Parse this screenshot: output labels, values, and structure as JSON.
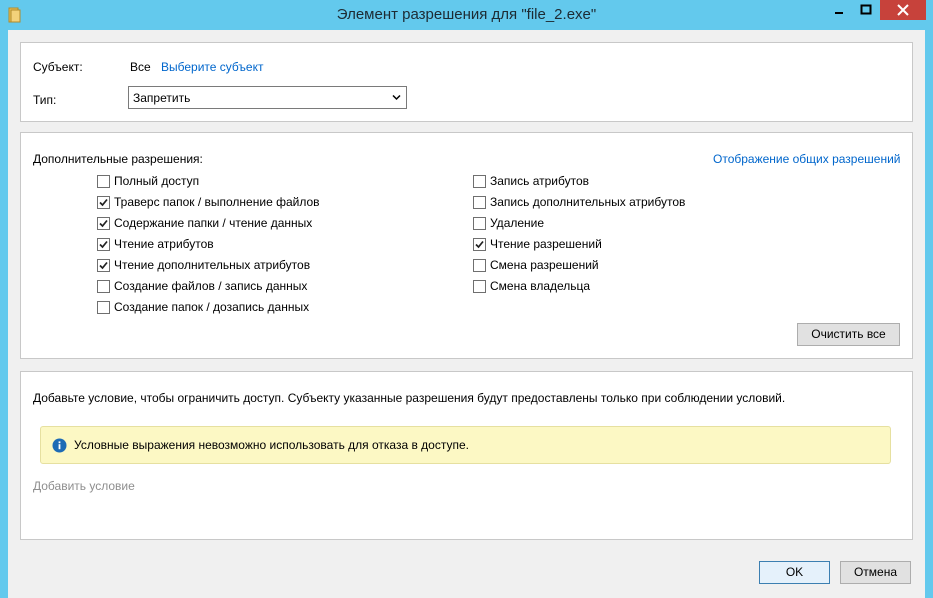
{
  "window": {
    "title": "Элемент разрешения для \"file_2.exe\""
  },
  "principal": {
    "label": "Субъект:",
    "value": "Все",
    "select_link": "Выберите субъект"
  },
  "type": {
    "label": "Тип:",
    "selected": "Запретить"
  },
  "permissions": {
    "heading": "Дополнительные разрешения:",
    "basic_link": "Отображение общих разрешений",
    "left": [
      {
        "label": "Полный доступ",
        "checked": false
      },
      {
        "label": "Траверс папок / выполнение файлов",
        "checked": true
      },
      {
        "label": "Содержание папки / чтение данных",
        "checked": true
      },
      {
        "label": "Чтение атрибутов",
        "checked": true
      },
      {
        "label": "Чтение дополнительных атрибутов",
        "checked": true
      },
      {
        "label": "Создание файлов / запись данных",
        "checked": false
      },
      {
        "label": "Создание папок / дозапись данных",
        "checked": false
      }
    ],
    "right": [
      {
        "label": "Запись атрибутов",
        "checked": false
      },
      {
        "label": "Запись дополнительных атрибутов",
        "checked": false
      },
      {
        "label": "Удаление",
        "checked": false
      },
      {
        "label": "Чтение разрешений",
        "checked": true
      },
      {
        "label": "Смена разрешений",
        "checked": false
      },
      {
        "label": "Смена владельца",
        "checked": false
      }
    ],
    "clear_all": "Очистить все"
  },
  "condition": {
    "description": "Добавьте условие, чтобы ограничить доступ. Субъекту указанные разрешения будут предоставлены только при соблюдении условий.",
    "info": "Условные выражения невозможно использовать для отказа в доступе.",
    "add_link": "Добавить условие"
  },
  "footer": {
    "ok": "OK",
    "cancel": "Отмена"
  }
}
